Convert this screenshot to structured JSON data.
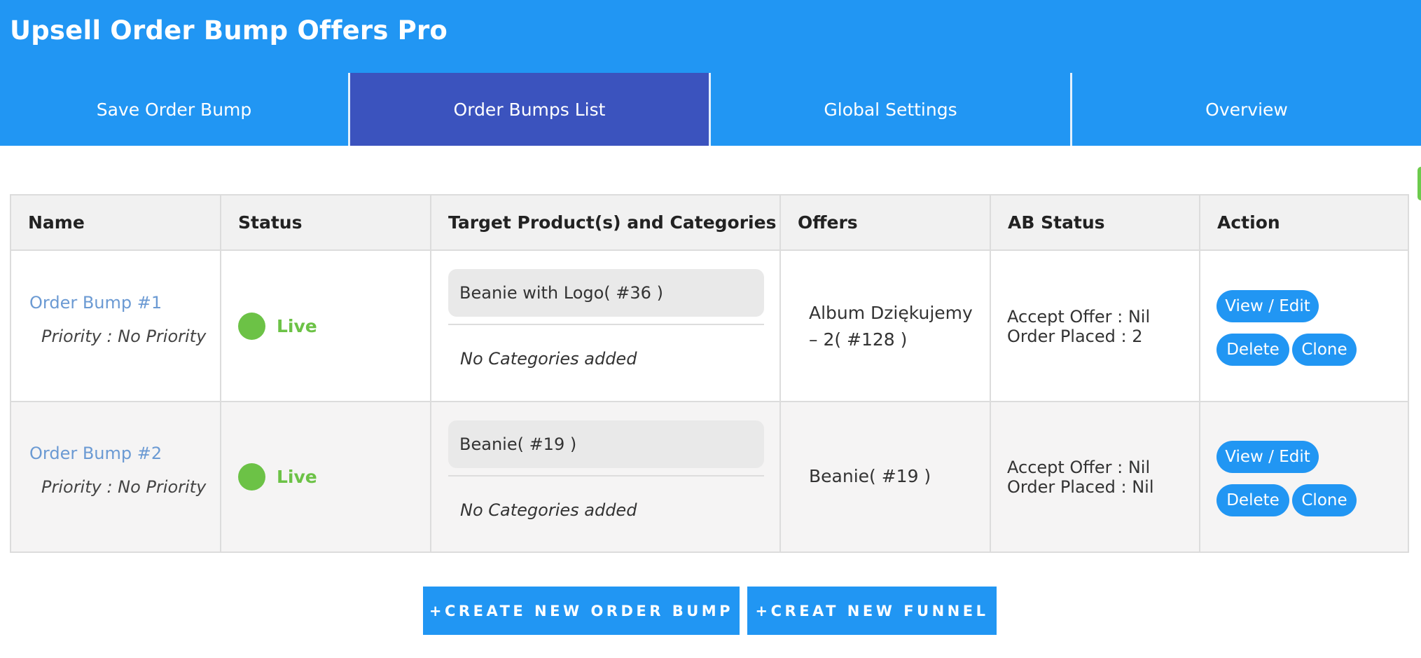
{
  "app": {
    "title": "Upsell Order Bump Offers Pro"
  },
  "tabs": [
    {
      "label": "Save Order Bump",
      "active": false
    },
    {
      "label": "Order Bumps List",
      "active": true
    },
    {
      "label": "Global Settings",
      "active": false
    },
    {
      "label": "Overview",
      "active": false
    }
  ],
  "table": {
    "headers": [
      "Name",
      "Status",
      "Target Product(s) and Categories",
      "Offers",
      "AB Status",
      "Action"
    ],
    "rows": [
      {
        "name": "Order Bump #1",
        "priority": "Priority : No Priority",
        "status": "Live",
        "target_product": "Beanie with Logo( #36 )",
        "categories": "No Categories added",
        "offer_line1": "Album Dziękujemy",
        "offer_line2": "– 2( #128 )",
        "accept_offer": "Accept Offer : Nil",
        "order_placed": "Order Placed : 2"
      },
      {
        "name": "Order Bump #2",
        "priority": "Priority : No Priority",
        "status": "Live",
        "target_product": "Beanie( #19 )",
        "categories": "No Categories added",
        "offer_line1": "Beanie( #19 )",
        "offer_line2": "",
        "accept_offer": "Accept Offer : Nil",
        "order_placed": "Order Placed : Nil"
      }
    ],
    "actions": {
      "view_edit": "View / Edit",
      "delete": "Delete",
      "clone": "Clone"
    }
  },
  "buttons": {
    "create_bump": "+CREATE NEW ORDER BUMP",
    "create_funnel": "+CREAT NEW FUNNEL"
  },
  "colors": {
    "primary": "#2196f3",
    "active_tab": "#3b53be",
    "live_green": "#6cc246",
    "link_blue": "#6b9ad3"
  }
}
